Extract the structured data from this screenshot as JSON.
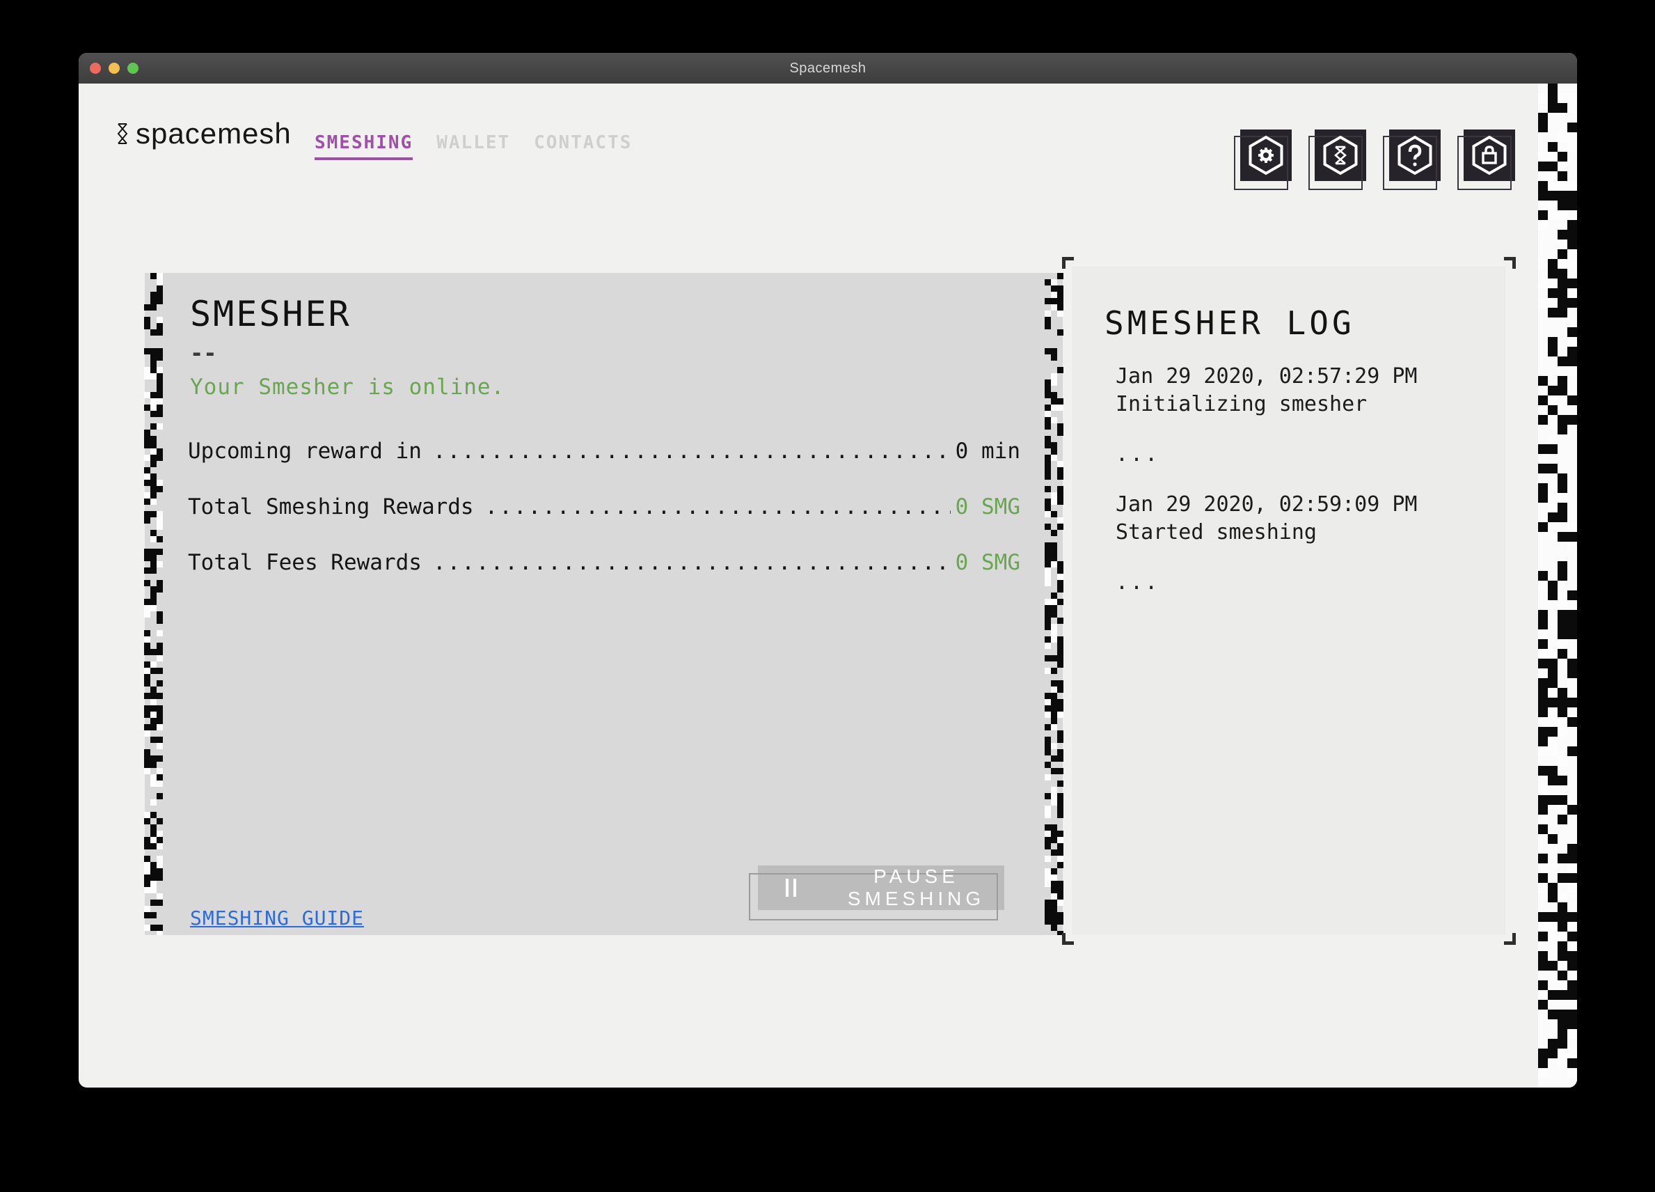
{
  "window": {
    "title": "Spacemesh"
  },
  "nav": {
    "logo_text": "spacemesh",
    "tabs": [
      {
        "label": "SMESHING",
        "active": true
      },
      {
        "label": "WALLET",
        "active": false
      },
      {
        "label": "CONTACTS",
        "active": false
      }
    ],
    "icons": [
      "settings",
      "network",
      "help",
      "lock"
    ]
  },
  "smesher": {
    "title": "SMESHER",
    "divider": "--",
    "status": "Your Smesher is online.",
    "rows": [
      {
        "label": "Upcoming reward in",
        "dots": "......................................................",
        "value": "0 min"
      },
      {
        "label": "Total Smeshing Rewards",
        "dots": "......................................................",
        "value": "0 SMG"
      },
      {
        "label": "Total Fees Rewards",
        "dots": "......................................................",
        "value": "0 SMG"
      }
    ],
    "guide_link": "SMESHING GUIDE",
    "pause_button": {
      "label": "PAUSE SMESHING"
    }
  },
  "log": {
    "title": "SMESHER LOG",
    "entries": [
      {
        "time": "Jan 29 2020, 02:57:29 PM",
        "text": "Initializing smesher"
      },
      {
        "sep": "..."
      },
      {
        "time": "Jan 29 2020, 02:59:09 PM",
        "text": "Started smeshing"
      },
      {
        "sep": "..."
      }
    ]
  },
  "colors": {
    "accent_purple": "#a04fa8",
    "status_green": "#68a74f",
    "link_blue": "#2c6bdb",
    "icon_button_bg": "#26242a",
    "pause_button_bg": "#bcbcbc"
  }
}
